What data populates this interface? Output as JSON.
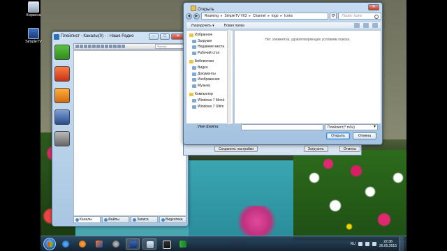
{
  "desktop": {
    "icons": [
      {
        "label": "Корзина"
      },
      {
        "label": "SimpleTV"
      }
    ]
  },
  "player": {
    "title": "Плейлист - Каналы(0) - : Наше Радио",
    "filter_placeholder": "Фильтр",
    "tabs": [
      "Каналы",
      "Файлы",
      "Записи",
      "Видеотека"
    ]
  },
  "settings_bar": {
    "buttons": [
      "Сохранить настройки",
      "Загрузить",
      "Отмена"
    ]
  },
  "dialog": {
    "title": "Открыть",
    "breadcrumb": [
      "Roaming",
      "SimpleTV V03",
      "Channel",
      "logo",
      "Icons"
    ],
    "search_placeholder": "Поиск: Icons",
    "cmd": {
      "organize": "Упорядочить ▾",
      "new_folder": "Новая папка"
    },
    "nav_pane": [
      {
        "label": "Избранное",
        "type": "hd"
      },
      {
        "label": "Загрузки",
        "type": "sub"
      },
      {
        "label": "Недавние места",
        "type": "sub"
      },
      {
        "label": "Рабочий стол",
        "type": "sub"
      },
      {
        "label": "Библиотеки",
        "type": "hd"
      },
      {
        "label": "Видео",
        "type": "sub"
      },
      {
        "label": "Документы",
        "type": "sub"
      },
      {
        "label": "Изображения",
        "type": "sub"
      },
      {
        "label": "Музыка",
        "type": "sub"
      },
      {
        "label": "Компьютер",
        "type": "hd"
      },
      {
        "label": "Windows 7 Monk",
        "type": "sub"
      },
      {
        "label": "Windows 7 Ultim",
        "type": "sub"
      }
    ],
    "empty_message": "Нет элементов, удовлетворяющих условиям поиска.",
    "filename_label": "Имя файла:",
    "filename_value": "",
    "filetype": "Плейлист(*.m3u)",
    "open_button": "Открыть",
    "cancel_button": "Отмена"
  },
  "taskbar": {
    "lang": "RU",
    "time": "22:38",
    "date": "26.05.2015"
  }
}
